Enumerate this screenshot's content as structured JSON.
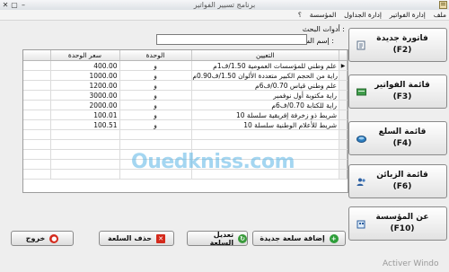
{
  "window": {
    "title": "برنامج تسيير الفواتير",
    "activation_text": "Activer Windo"
  },
  "menu": [
    "ملف",
    "إدارة الفواتير",
    "إدارة الجداول",
    "المؤسسة",
    "؟"
  ],
  "search": {
    "tools_label": "أدوات البحث :",
    "name_label": "إسم السلعة :",
    "value": ""
  },
  "table": {
    "headers": {
      "name": "التعيين",
      "unit": "الوحدة",
      "price": "سعر الوحدة"
    },
    "rows": [
      {
        "name": "علم وطني للمؤسسات العمومية 1.50/ف1م",
        "unit": "و",
        "price": "400.00"
      },
      {
        "name": "راية من الحجم الكبير متعددة الألوان 1.50/ف0.90م",
        "unit": "و",
        "price": "1000.00"
      },
      {
        "name": "علم وطني قياس 0.70/ف6م",
        "unit": "و",
        "price": "1200.00"
      },
      {
        "name": "راية مكتوبة أول نوفمبر",
        "unit": "و",
        "price": "3000.00"
      },
      {
        "name": "راية للكتابة 0.70/ف6م",
        "unit": "و",
        "price": "2000.00"
      },
      {
        "name": "شريط ذو زخرفة إفريقية سلسلة 10",
        "unit": "و",
        "price": "100.01"
      },
      {
        "name": "شريط للأعلام الوطنية سلسلة 10",
        "unit": "و",
        "price": "100.51"
      }
    ]
  },
  "watermark": "Ouedkniss.com",
  "buttons": {
    "add": "إضافة سلعة جديدة",
    "edit": "تعديل السلعة",
    "delete": "حذف السلعة",
    "exit": "خروج"
  },
  "side": [
    {
      "label": "فاتورة جديدة",
      "key": "(F2)",
      "icon": "new-invoice-icon"
    },
    {
      "label": "قائمة الفواتير",
      "key": "(F3)",
      "icon": "invoice-list-icon"
    },
    {
      "label": "قائمة السلع",
      "key": "(F4)",
      "icon": "goods-list-icon"
    },
    {
      "label": "قائمة الزبائن",
      "key": "(F6)",
      "icon": "customers-icon"
    },
    {
      "label": "عن المؤسسة",
      "key": "(F10)",
      "icon": "company-icon"
    }
  ]
}
